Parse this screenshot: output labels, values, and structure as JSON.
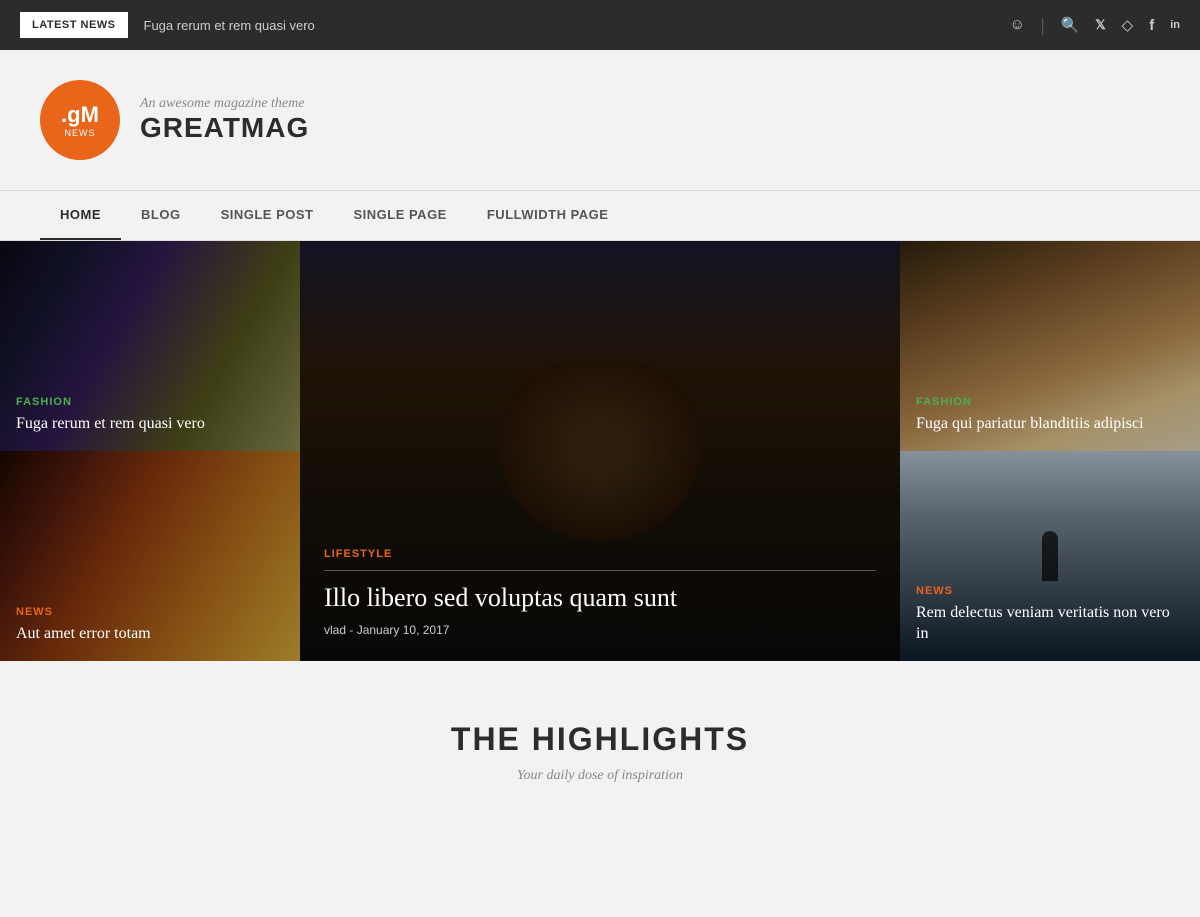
{
  "topbar": {
    "latest_news_label": "LATEST NEWS",
    "ticker": "Fuga rerum et rem quasi vero"
  },
  "header": {
    "logo_gm": ".gM",
    "logo_news": "NEWS",
    "tagline": "An awesome magazine theme",
    "site_name": "GREATMAG"
  },
  "nav": {
    "items": [
      {
        "label": "HOME",
        "active": true
      },
      {
        "label": "BLOG",
        "active": false
      },
      {
        "label": "SINGLE POST",
        "active": false
      },
      {
        "label": "SINGLE PAGE",
        "active": false
      },
      {
        "label": "FULLWIDTH PAGE",
        "active": false
      }
    ]
  },
  "hero": {
    "top_left": {
      "category": "FASHION",
      "title": "Fuga rerum et rem quasi vero"
    },
    "center": {
      "category": "LIFESTYLE",
      "title": "Illo libero sed voluptas quam sunt",
      "author": "vlad",
      "date": "January 10, 2017"
    },
    "top_right": {
      "category": "FASHION",
      "title": "Fuga qui pariatur blanditiis adipisci"
    },
    "bottom_left": {
      "category": "NEWS",
      "title": "Aut amet error totam"
    },
    "bottom_right": {
      "category": "NEWS",
      "title": "Rem delectus veniam veritatis non vero in"
    }
  },
  "highlights": {
    "title": "THE HIGHLIGHTS",
    "subtitle": "Your daily dose of inspiration"
  }
}
